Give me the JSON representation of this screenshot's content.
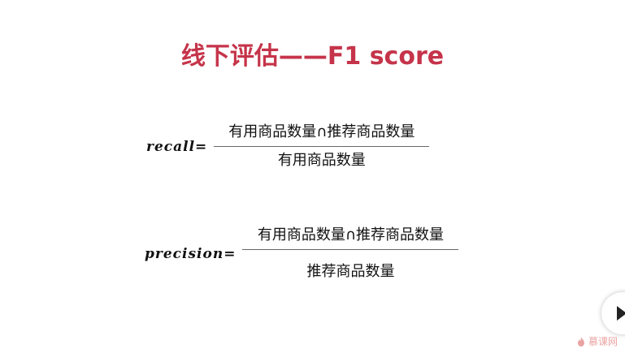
{
  "slide": {
    "title": "线下评估——F1 score"
  },
  "formulas": {
    "recall": {
      "label": "recall=",
      "numerator": "有用商品数量∩推荐商品数量",
      "denominator": "有用商品数量"
    },
    "precision": {
      "label": "precision=",
      "numerator": "有用商品数量∩推荐商品数量",
      "denominator": "推荐商品数量"
    }
  },
  "player": {
    "next_icon": "play-triangle-icon"
  },
  "watermark": {
    "text": "慕课网",
    "icon": "flame-icon"
  },
  "colors": {
    "title": "#c5344a",
    "watermark": "#e89a9a"
  }
}
